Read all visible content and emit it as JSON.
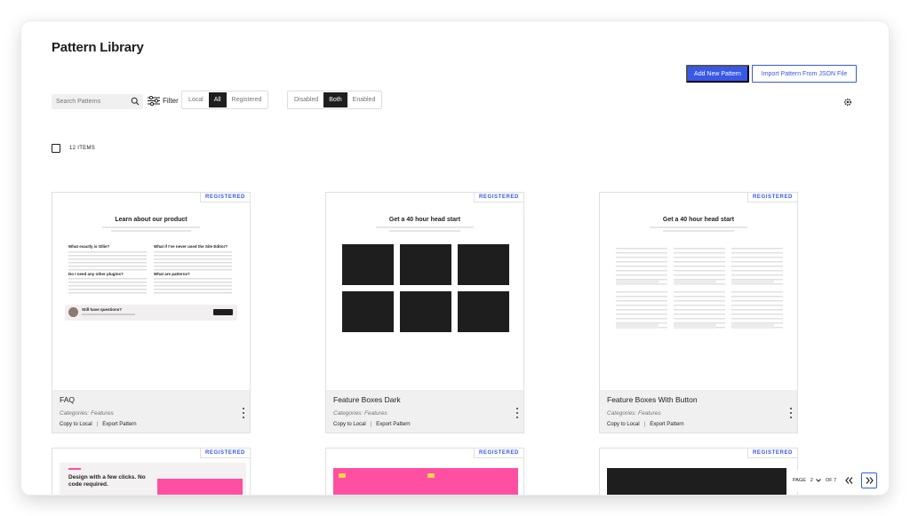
{
  "header": {
    "title": "Pattern Library"
  },
  "actions": {
    "add_new": "Add New Pattern",
    "import_json": "Import Pattern From JSON File"
  },
  "search": {
    "placeholder": "Search Patterns"
  },
  "filter": {
    "label": "Filter"
  },
  "source_toggle": {
    "options": [
      "Local",
      "All",
      "Registered"
    ],
    "selected": "All"
  },
  "status_toggle": {
    "options": [
      "Disabled",
      "Both",
      "Enabled"
    ],
    "selected": "Both"
  },
  "list": {
    "count_label": "12 ITEMS"
  },
  "card_labels": {
    "badge": "REGISTERED",
    "copy": "Copy to Local",
    "sep": "|",
    "export": "Export Pattern"
  },
  "cards": [
    {
      "name": "FAQ",
      "categories": "Categories: Features"
    },
    {
      "name": "Feature Boxes Dark",
      "categories": "Categories: Features"
    },
    {
      "name": "Feature Boxes With Button",
      "categories": "Categories: Features"
    }
  ],
  "previews": {
    "faq": {
      "title": "Learn about our product",
      "q1": "What exactly is Ollie?",
      "q2": "What if I've never used the Site Editor?",
      "q3": "Do I need any other plugins?",
      "q4": "What are patterns?",
      "cta": "Still have questions?"
    },
    "boxes": {
      "title": "Get a 40 hour head start"
    },
    "bottom1": {
      "title": "Design with a few clicks. No code required."
    }
  },
  "pagination": {
    "label": "PAGE",
    "current": "2",
    "of": "OF 7"
  },
  "colors": {
    "accent": "#3858e9",
    "dark": "#1e1e1e",
    "pink": "#ff4fa3"
  }
}
